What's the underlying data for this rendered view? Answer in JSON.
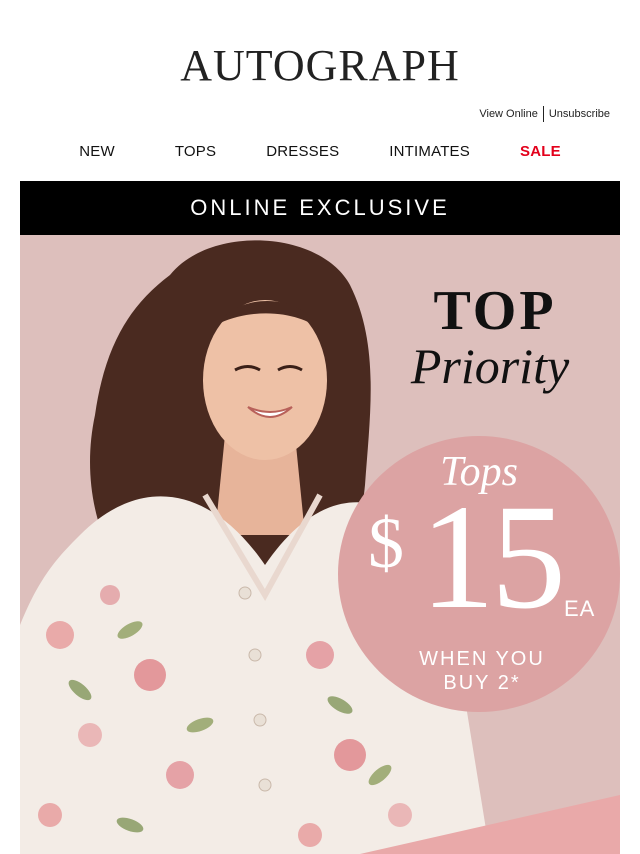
{
  "brand": {
    "logo_text": "AUTOGRAPH"
  },
  "utility": {
    "view_online": "View Online",
    "unsubscribe": "Unsubscribe"
  },
  "nav": {
    "items": [
      {
        "label": "NEW"
      },
      {
        "label": "TOPS"
      },
      {
        "label": "DRESSES"
      },
      {
        "label": "INTIMATES"
      },
      {
        "label": "SALE",
        "color": "#e3001b"
      }
    ]
  },
  "banner": {
    "text": "ONLINE EXCLUSIVE",
    "background": "#000000"
  },
  "hero": {
    "headline_line1": "TOP",
    "headline_line2": "Priority",
    "offer": {
      "category": "Tops",
      "currency": "$",
      "price": "15",
      "unit": "EA",
      "condition_line1": "WHEN YOU",
      "condition_line2": "BUY 2*",
      "circle_color": "#dca3a3"
    },
    "background_color": "#ddbfbc"
  }
}
